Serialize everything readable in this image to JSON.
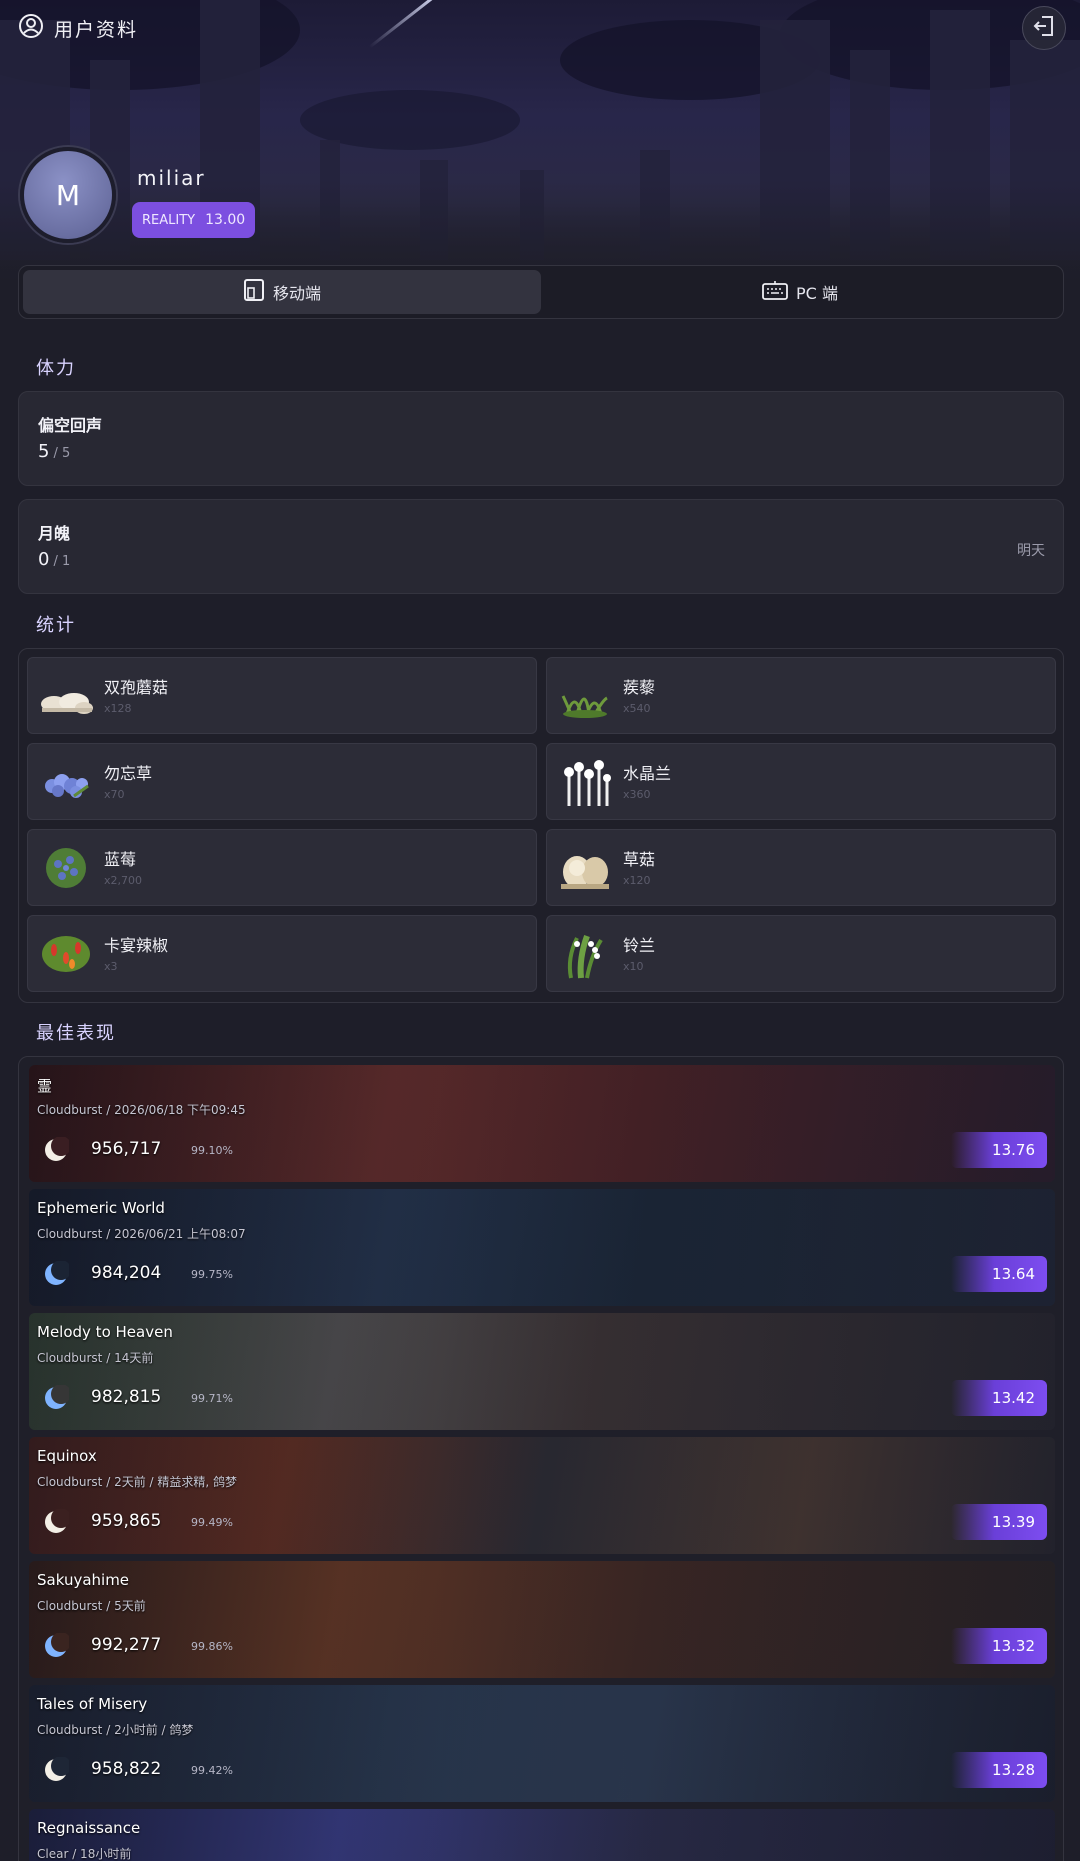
{
  "header": {
    "title": "用户资料"
  },
  "profile": {
    "avatar_letter": "M",
    "username": "miliar",
    "reality_label": "REALITY",
    "reality_value": "13.00"
  },
  "platform_tabs": [
    {
      "label": "移动端",
      "icon": "tablet-icon",
      "active": true
    },
    {
      "label": "PC 端",
      "icon": "keyboard-icon",
      "active": false
    }
  ],
  "stamina": {
    "title": "体力",
    "items": [
      {
        "name": "偏空回声",
        "current": "5",
        "max": "/ 5",
        "reset": ""
      },
      {
        "name": "月魄",
        "current": "0",
        "max": "/ 1",
        "reset": "明天"
      }
    ]
  },
  "stats": {
    "title": "统计",
    "items": [
      {
        "name": "双孢蘑菇",
        "count": "x128",
        "icon": "mushroom-icon"
      },
      {
        "name": "蒺藜",
        "count": "x540",
        "icon": "grass-icon"
      },
      {
        "name": "勿忘草",
        "count": "x70",
        "icon": "forget-me-not-icon"
      },
      {
        "name": "水晶兰",
        "count": "x360",
        "icon": "ghost-plant-icon"
      },
      {
        "name": "蓝莓",
        "count": "x2,700",
        "icon": "blueberry-icon"
      },
      {
        "name": "草菇",
        "count": "x120",
        "icon": "straw-mushroom-icon"
      },
      {
        "name": "卡宴辣椒",
        "count": "x3",
        "icon": "chili-icon"
      },
      {
        "name": "铃兰",
        "count": "x10",
        "icon": "lily-of-valley-icon"
      }
    ]
  },
  "best": {
    "title": "最佳表现",
    "plays": [
      {
        "title": "霊",
        "subtitle": "Cloudburst / 2026/06/18 下午09:45",
        "score": "956,717",
        "accuracy": "99.10%",
        "rating": "13.76",
        "moon": "crescent-icon"
      },
      {
        "title": "Ephemeric World",
        "subtitle": "Cloudburst / 2026/06/21 上午08:07",
        "score": "984,204",
        "accuracy": "99.75%",
        "rating": "13.64",
        "moon": "blue-crescent-icon"
      },
      {
        "title": "Melody to Heaven",
        "subtitle": "Cloudburst / 14天前",
        "score": "982,815",
        "accuracy": "99.71%",
        "rating": "13.42",
        "moon": "blue-crescent-icon"
      },
      {
        "title": "Equinox",
        "subtitle": "Cloudburst / 2天前 / 精益求精, 鸽梦",
        "score": "959,865",
        "accuracy": "99.49%",
        "rating": "13.39",
        "moon": "crescent-icon"
      },
      {
        "title": "Sakuyahime",
        "subtitle": "Cloudburst / 5天前",
        "score": "992,277",
        "accuracy": "99.86%",
        "rating": "13.32",
        "moon": "blue-crescent-icon"
      },
      {
        "title": "Tales of Misery",
        "subtitle": "Cloudburst / 2小时前 / 鸽梦",
        "score": "958,822",
        "accuracy": "99.42%",
        "rating": "13.28",
        "moon": "crescent-icon"
      },
      {
        "title": "Regnaissance",
        "subtitle": "Clear / 18小时前",
        "score": "",
        "accuracy": "",
        "rating": "",
        "moon": ""
      }
    ]
  },
  "colors": {
    "accent": "#7c4fe0",
    "background": "#1e1e29",
    "card": "#282833"
  }
}
